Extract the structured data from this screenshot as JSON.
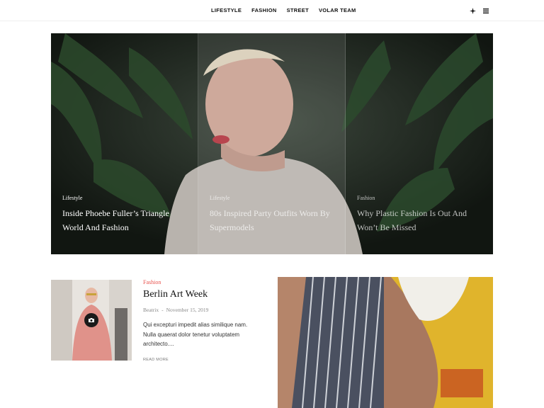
{
  "nav": {
    "items": [
      {
        "label": "LIFESTYLE"
      },
      {
        "label": "FASHION"
      },
      {
        "label": "STREET"
      },
      {
        "label": "VOLAR TEAM"
      }
    ]
  },
  "header_icons": {
    "flash": "flash-icon",
    "menu": "menu-icon"
  },
  "hero": {
    "columns": [
      {
        "category": "Lifestyle",
        "title": "Inside Phoebe Fuller’s Triangle World And Fashion"
      },
      {
        "category": "Lifestyle",
        "title": "80s Inspired Party Outfits Worn By Supermodels"
      },
      {
        "category": "Fashion",
        "title": "Why Plastic Fashion Is Out And Won’t Be Missed"
      }
    ]
  },
  "post": {
    "category": "Fashion",
    "title": "Berlin Art Week",
    "author": "Beatrix",
    "separator": "-",
    "date": "November 15, 2019",
    "excerpt": "Qui excepturi impedit alias similique nam. Nulla quaerat dolor tenetur voluptatem architecto....",
    "read_more": "READ MORE",
    "badge_icon": "camera-icon"
  },
  "colors": {
    "accent": "#e8534e",
    "hero_bg": "#1c221d",
    "text": "#111111"
  }
}
